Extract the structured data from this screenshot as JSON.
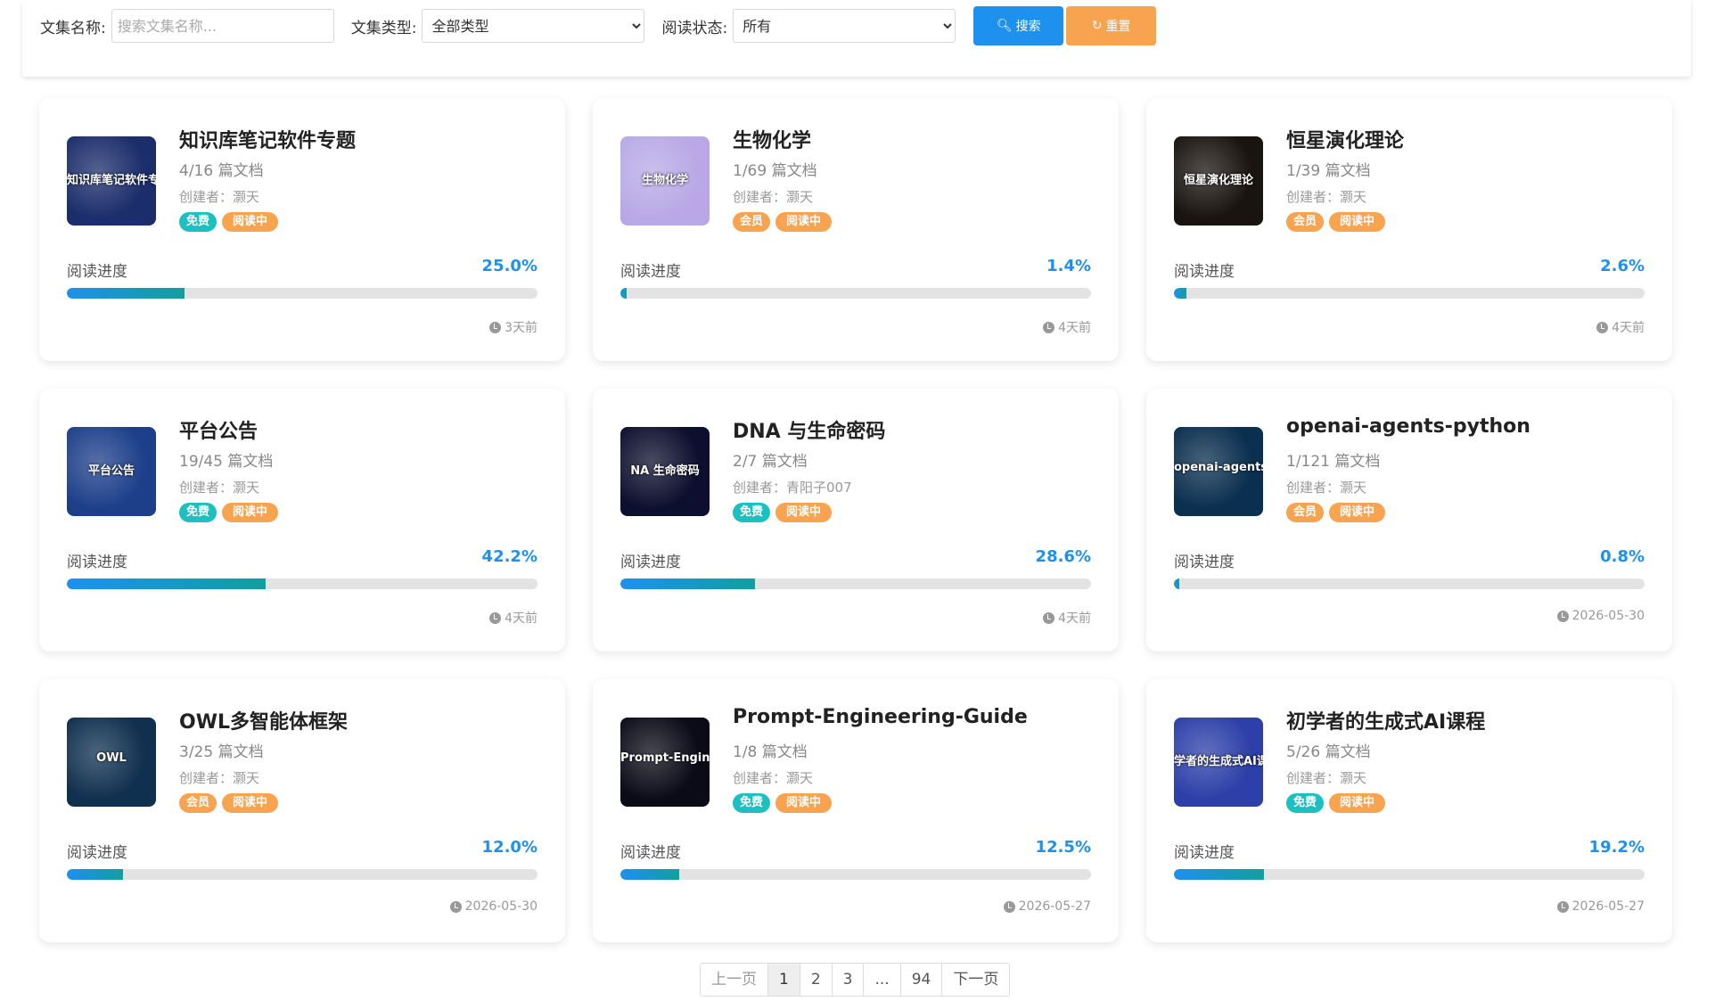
{
  "filter": {
    "name_label": "文集名称:",
    "name_placeholder": "搜索文集名称...",
    "type_label": "文集类型:",
    "type_value": "全部类型",
    "status_label": "阅读状态:",
    "status_value": "所有",
    "search_label": "搜索",
    "reset_label": "重置"
  },
  "progress_label": "阅读进度",
  "cards": [
    {
      "title": "知识库笔记软件专题",
      "docs": "4/16 篇文档",
      "creator": "创建者：灏天",
      "tags": [
        "免费",
        "阅读中"
      ],
      "pct": "25.0%",
      "pct_value": 25.0,
      "time": "3天前",
      "thumb_caption": "知识库笔记软件专题",
      "thumb_bg": "#1b2d6b"
    },
    {
      "title": "生物化学",
      "docs": "1/69 篇文档",
      "creator": "创建者：灏天",
      "tags": [
        "会员",
        "阅读中"
      ],
      "pct": "1.4%",
      "pct_value": 1.4,
      "time": "4天前",
      "thumb_caption": "生物化学",
      "thumb_bg": "#b8a9e6"
    },
    {
      "title": "恒星演化理论",
      "docs": "1/39 篇文档",
      "creator": "创建者：灏天",
      "tags": [
        "会员",
        "阅读中"
      ],
      "pct": "2.6%",
      "pct_value": 2.6,
      "time": "4天前",
      "thumb_caption": "恒星演化理论",
      "thumb_bg": "#1a1410"
    },
    {
      "title": "平台公告",
      "docs": "19/45 篇文档",
      "creator": "创建者：灏天",
      "tags": [
        "免费",
        "阅读中"
      ],
      "pct": "42.2%",
      "pct_value": 42.2,
      "time": "4天前",
      "thumb_caption": "平台公告",
      "thumb_bg": "#1d3f8a"
    },
    {
      "title": "DNA 与生命密码",
      "docs": "2/7 篇文档",
      "creator": "创建者：青阳子007",
      "tags": [
        "免费",
        "阅读中"
      ],
      "pct": "28.6%",
      "pct_value": 28.6,
      "time": "4天前",
      "thumb_caption": "NA 生命密码",
      "thumb_bg": "#0d0f2e"
    },
    {
      "title": "openai-agents-python",
      "docs": "1/121 篇文档",
      "creator": "创建者：灏天",
      "tags": [
        "会员",
        "阅读中"
      ],
      "pct": "0.8%",
      "pct_value": 0.8,
      "time": "2026-05-30",
      "thumb_caption": "openai-agents",
      "thumb_bg": "#0a2f4f"
    },
    {
      "title": "OWL多智能体框架",
      "docs": "3/25 篇文档",
      "creator": "创建者：灏天",
      "tags": [
        "会员",
        "阅读中"
      ],
      "pct": "12.0%",
      "pct_value": 12.0,
      "time": "2026-05-30",
      "thumb_caption": "OWL",
      "thumb_bg": "#10304f"
    },
    {
      "title": "Prompt-Engineering-Guide",
      "docs": "1/8 篇文档",
      "creator": "创建者：灏天",
      "tags": [
        "免费",
        "阅读中"
      ],
      "pct": "12.5%",
      "pct_value": 12.5,
      "time": "2026-05-27",
      "thumb_caption": "Prompt-Engineering-Guide",
      "thumb_bg": "#0b0b18"
    },
    {
      "title": "初学者的生成式AI课程",
      "docs": "5/26 篇文档",
      "creator": "创建者：灏天",
      "tags": [
        "免费",
        "阅读中"
      ],
      "pct": "19.2%",
      "pct_value": 19.2,
      "time": "2026-05-27",
      "thumb_caption": "学者的生成式AI课程",
      "thumb_bg": "#2d3fa8"
    }
  ],
  "pager": {
    "prev": "上一页",
    "pages": [
      "1",
      "2",
      "3",
      "...",
      "94"
    ],
    "next": "下一页",
    "active": "1"
  },
  "colors": {
    "primary": "#1e90ee",
    "accent_orange": "#f7a34f",
    "free_tag": "#1cc0c0",
    "progress_end": "#129f9f"
  }
}
